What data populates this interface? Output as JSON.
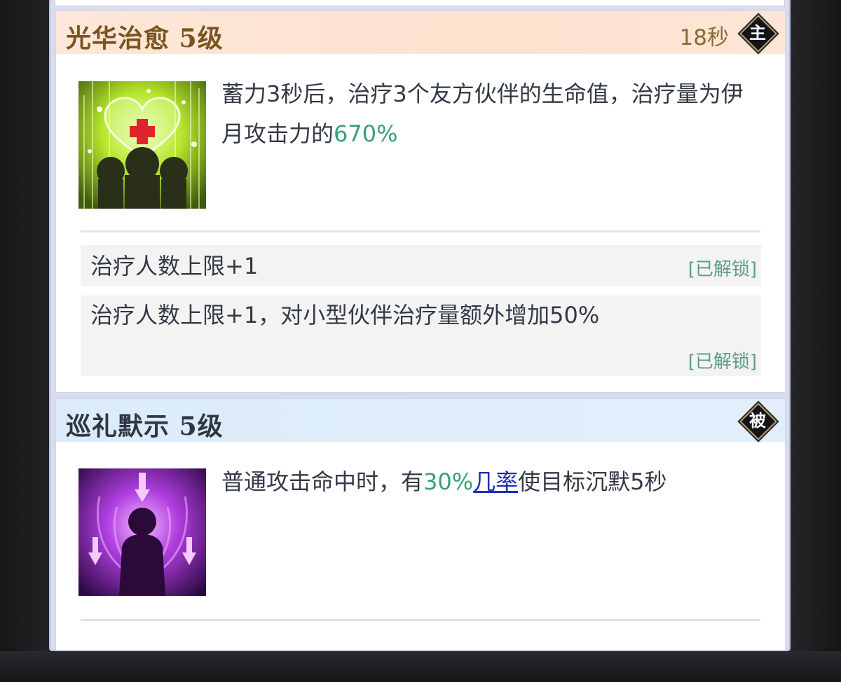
{
  "skills": [
    {
      "name": "光华治愈",
      "level": "5级",
      "cooldown": "18秒",
      "type_badge": "主",
      "icon": "healing-light-icon",
      "description": {
        "prefix": "蓄力3秒后，治疗3个友方伙伴的生命值，治疗量为伊月攻击力的",
        "highlight": "670%"
      },
      "upgrades": [
        {
          "text": "治疗人数上限+1",
          "status": "[已解锁]"
        },
        {
          "text": "治疗人数上限+1，对小型伙伴治疗量额外增加50%",
          "status": "[已解锁]"
        }
      ]
    },
    {
      "name": "巡礼默示",
      "level": "5级",
      "type_badge": "被",
      "icon": "silence-aura-icon",
      "description": {
        "prefix": "普通攻击命中时，有",
        "highlight": "30%",
        "link": "几率",
        "suffix": "使目标沉默5秒"
      }
    }
  ],
  "colors": {
    "highlight": "#3a9e7a",
    "link": "#1a2fb0",
    "unlocked": "#5d9d84",
    "active_header": "#fde2cf",
    "passive_header": "#dcebfa"
  }
}
